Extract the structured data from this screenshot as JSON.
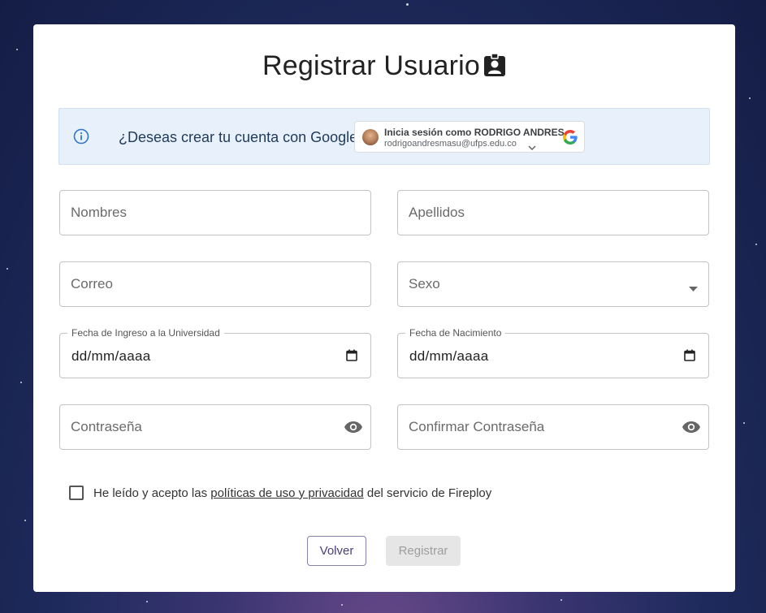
{
  "form": {
    "title": "Registrar Usuario",
    "google": {
      "question": "¿Deseas crear tu cuenta con Google?",
      "signin_name": "Inicia sesión como RODRIGO ANDRES",
      "signin_email": "rodrigoandresmasu@ufps.edu.co"
    },
    "fields": {
      "nombres": {
        "placeholder": "Nombres"
      },
      "apellidos": {
        "placeholder": "Apellidos"
      },
      "correo": {
        "placeholder": "Correo"
      },
      "sexo": {
        "placeholder": "Sexo"
      },
      "fecha_ingreso": {
        "label": "Fecha de Ingreso a la Universidad",
        "value": "dd/mm/aaaa"
      },
      "fecha_nacimiento": {
        "label": "Fecha de Nacimiento",
        "value": "dd/mm/aaaa"
      },
      "contrasena": {
        "placeholder": "Contraseña"
      },
      "confirmar": {
        "placeholder": "Confirmar Contraseña"
      }
    },
    "terms": {
      "prefix": "He leído y acepto las",
      "link": "políticas de uso y privacidad",
      "suffix": "del servicio de Fireploy",
      "checked": false
    },
    "buttons": {
      "back": "Volver",
      "register": "Registrar"
    }
  }
}
